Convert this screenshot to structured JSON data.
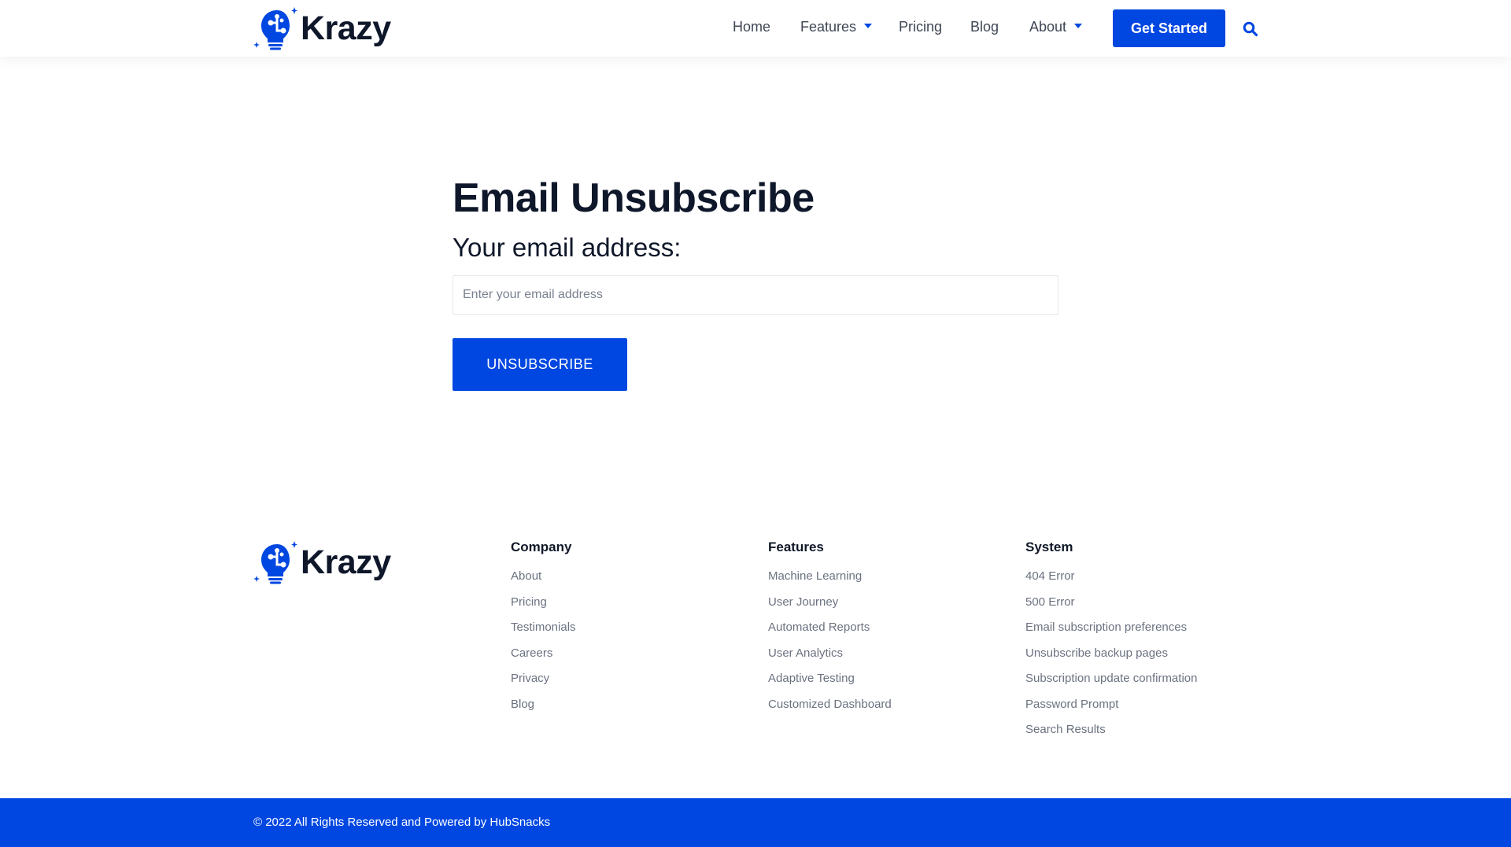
{
  "brand": {
    "name": "Krazy",
    "accent_color": "#0047e1",
    "text_color": "#0f172a"
  },
  "header": {
    "nav": [
      {
        "label": "Home",
        "has_dropdown": false
      },
      {
        "label": "Features",
        "has_dropdown": true
      },
      {
        "label": "Pricing",
        "has_dropdown": false
      },
      {
        "label": "Blog",
        "has_dropdown": false
      },
      {
        "label": "About",
        "has_dropdown": true
      }
    ],
    "cta_label": "Get Started",
    "search_icon": "search-icon"
  },
  "main": {
    "title": "Email Unsubscribe",
    "email_label": "Your email address:",
    "email_placeholder": "Enter your email address",
    "email_value": "",
    "submit_label": "UNSUBSCRIBE"
  },
  "footer": {
    "columns": [
      {
        "heading": "Company",
        "links": [
          "About",
          "Pricing",
          "Testimonials",
          "Careers",
          "Privacy",
          "Blog"
        ]
      },
      {
        "heading": "Features",
        "links": [
          "Machine Learning",
          "User Journey",
          "Automated Reports",
          "User Analytics",
          "Adaptive Testing",
          "Customized Dashboard"
        ]
      },
      {
        "heading": "System",
        "links": [
          "404 Error",
          "500 Error",
          "Email subscription preferences",
          "Unsubscribe backup pages",
          "Subscription update confirmation",
          "Password Prompt",
          "Search Results"
        ]
      }
    ],
    "copyright": "© 2022 All Rights Reserved and Powered by HubSnacks"
  }
}
